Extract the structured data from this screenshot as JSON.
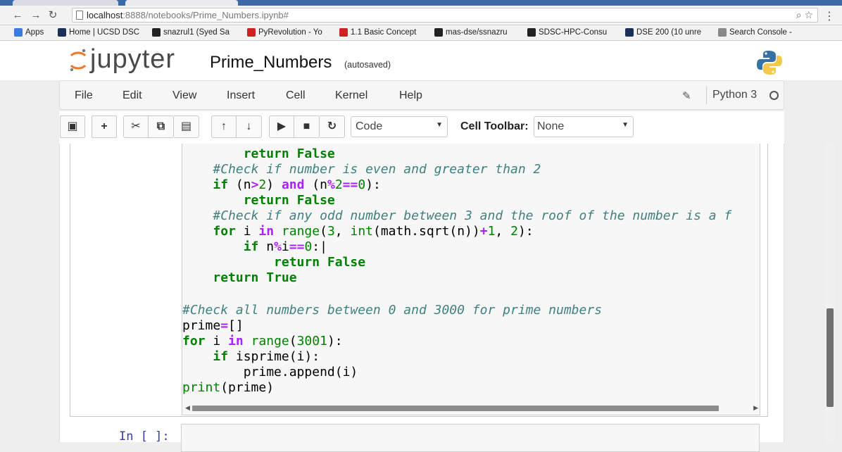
{
  "browser": {
    "url_host": "localhost",
    "url_path": ":8888/notebooks/Prime_Numbers.ipynb#",
    "bookmarks": [
      {
        "label": "Apps",
        "color": "#3d7be0"
      },
      {
        "label": "Home | UCSD DSC",
        "color": "#1a2f5a"
      },
      {
        "label": "snazrul1 (Syed Sa",
        "color": "#222222"
      },
      {
        "label": "PyRevolution - Yo",
        "color": "#cc2222"
      },
      {
        "label": "1.1 Basic Concept",
        "color": "#cc2222"
      },
      {
        "label": "mas-dse/ssnazru",
        "color": "#222222"
      },
      {
        "label": "SDSC-HPC-Consu",
        "color": "#222222"
      },
      {
        "label": "DSE 200 (10 unre",
        "color": "#1a2f5a"
      },
      {
        "label": "Search Console -",
        "color": "#888888"
      }
    ]
  },
  "jupyter": {
    "wordmark": "jupyter",
    "notebook_title": "Prime_Numbers",
    "autosave_status": "(autosaved)",
    "kernel_name": "Python 3",
    "menu": [
      "File",
      "Edit",
      "View",
      "Insert",
      "Cell",
      "Kernel",
      "Help"
    ],
    "toolbar": {
      "cell_type": "Code",
      "cell_toolbar_label": "Cell Toolbar:",
      "cell_toolbar_value": "None"
    }
  },
  "cells": {
    "next_prompt": "In [ ]:"
  },
  "colors": {
    "keyword": "#008000",
    "operator": "#aa22ff",
    "comment": "#408080",
    "jupyter_orange": "#f37726",
    "prompt_blue": "#303f9f"
  }
}
